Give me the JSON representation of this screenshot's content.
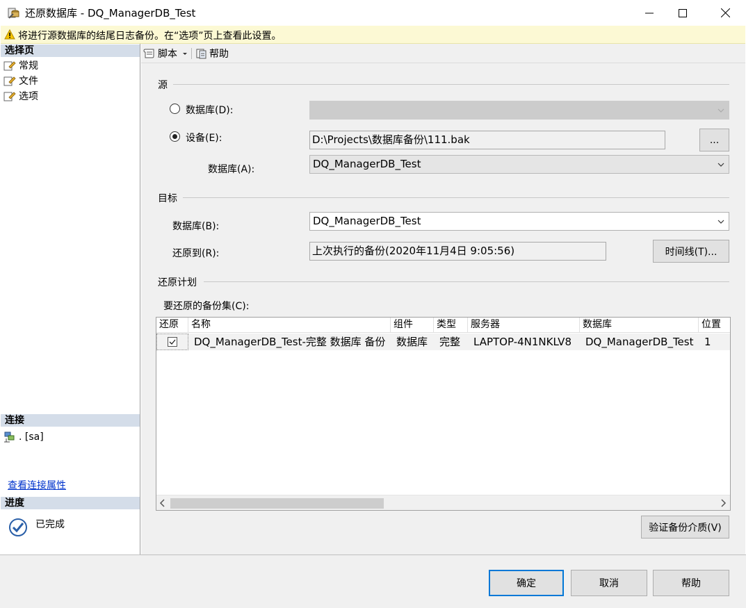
{
  "window": {
    "title": "还原数据库 - DQ_ManagerDB_Test"
  },
  "warning": {
    "text": "将进行源数据库的结尾日志备份。在“选项”页上查看此设置。",
    "color": "#fcf9d4"
  },
  "sidebar": {
    "select_page_header": "选择页",
    "pages": [
      {
        "label": "常规",
        "icon": "page-icon"
      },
      {
        "label": "文件",
        "icon": "page-icon"
      },
      {
        "label": "选项",
        "icon": "page-icon"
      }
    ],
    "connection_header": "连接",
    "connection_value": ". [sa]",
    "connection_icon": "server-icon",
    "view_connection_link": "查看连接属性",
    "progress_header": "进度",
    "progress_status": "已完成",
    "progress_icon": "checkmark-circle-icon"
  },
  "toolbar": {
    "script_label": "脚本",
    "help_label": "帮助"
  },
  "source": {
    "section_label": "源",
    "database_radio_label": "数据库(D):",
    "database_radio_checked": false,
    "device_radio_label": "设备(E):",
    "device_radio_checked": true,
    "device_path": "D:\\Projects\\数据库备份\\111.bak",
    "browse_label": "...",
    "device_db_label": "数据库(A):",
    "device_db_value": "DQ_ManagerDB_Test"
  },
  "target": {
    "section_label": "目标",
    "database_label": "数据库(B):",
    "database_value": "DQ_ManagerDB_Test",
    "restore_to_label": "还原到(R):",
    "restore_to_value": "上次执行的备份(2020年11月4日 9:05:56)",
    "timeline_label": "时间线(T)..."
  },
  "plan": {
    "section_label": "还原计划",
    "backup_sets_label": "要还原的备份集(C):",
    "columns": [
      "还原",
      "名称",
      "组件",
      "类型",
      "服务器",
      "数据库",
      "位置"
    ],
    "rows": [
      {
        "restore": true,
        "name": "DQ_ManagerDB_Test-完整 数据库 备份",
        "component": "数据库",
        "type": "完整",
        "server": "LAPTOP-4N1NKLV8",
        "database": "DQ_ManagerDB_Test",
        "position": "1"
      }
    ],
    "verify_label": "验证备份介质(V)"
  },
  "footer": {
    "ok_label": "确定",
    "cancel_label": "取消",
    "help_label": "帮助",
    "accent": "#0078d7"
  }
}
